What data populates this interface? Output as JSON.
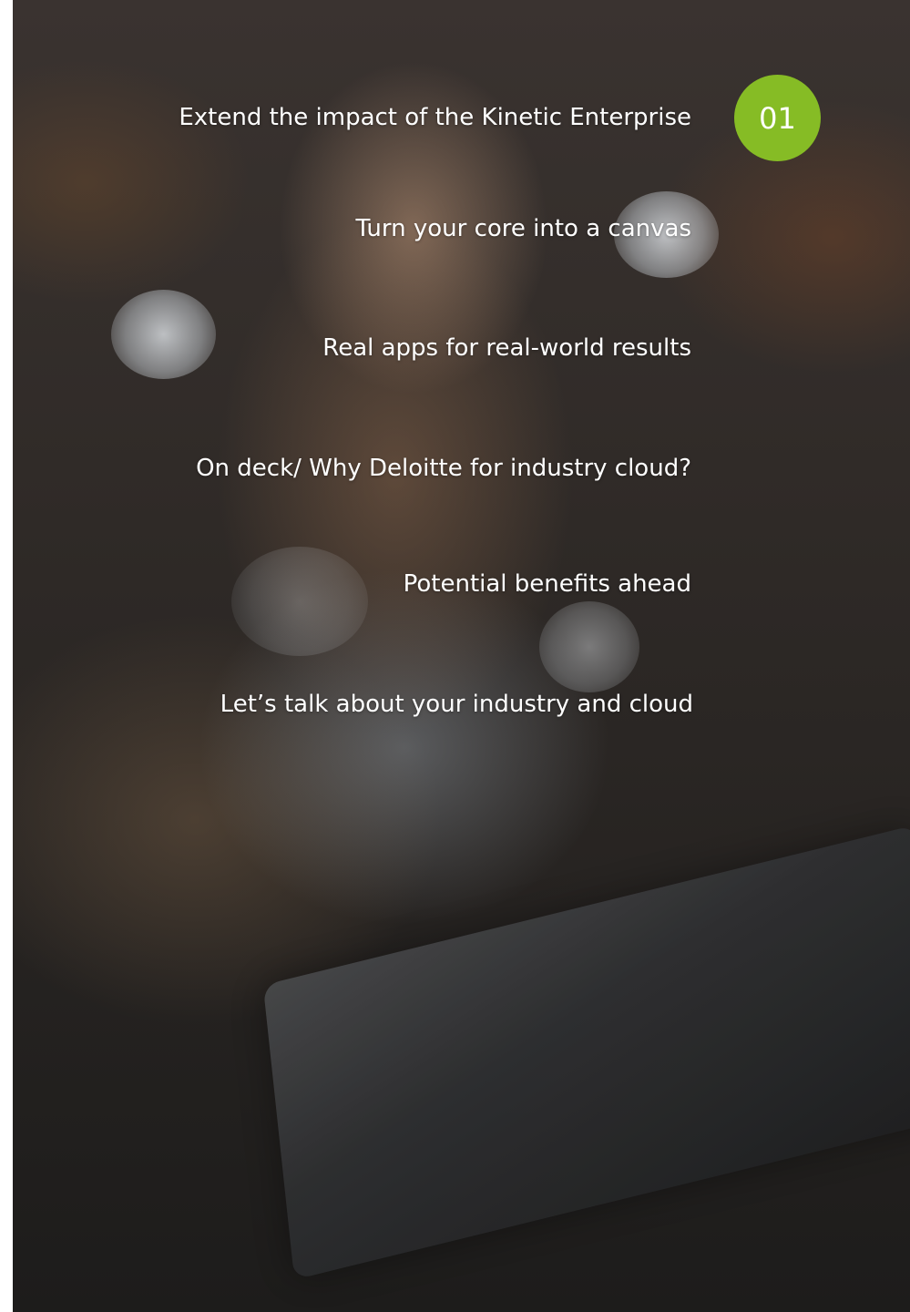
{
  "menu": {
    "active_index": "01",
    "items": [
      {
        "label": "Extend the impact of the Kinetic Enterprise"
      },
      {
        "label": "Turn your core into a canvas"
      },
      {
        "label": "Real apps for real-world results"
      },
      {
        "label": "On deck/ Why Deloitte for industry cloud?"
      },
      {
        "label": "Potential benefits ahead"
      },
      {
        "label": "Let’s talk about your industry and cloud"
      }
    ]
  },
  "colors": {
    "accent": "#86bc25",
    "text": "#ffffff"
  }
}
